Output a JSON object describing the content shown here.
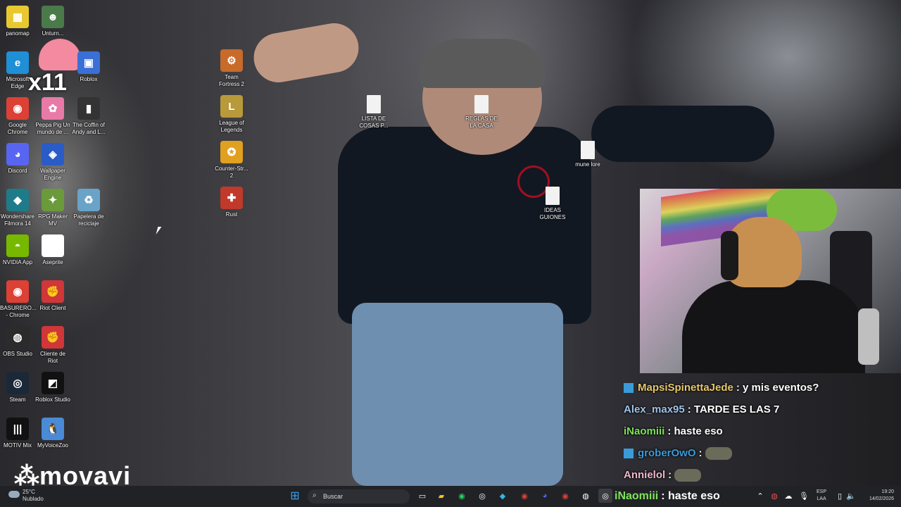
{
  "desktop": {
    "icons": [
      {
        "label": "panomap",
        "color": "#e8c830",
        "glyph": "▦"
      },
      {
        "label": "Unturn...",
        "color": "#4b7a4a",
        "glyph": "☻"
      },
      {
        "label": "Microsoft Edge",
        "color": "#1f8fd6",
        "glyph": "e"
      },
      {
        "label": "Roblox",
        "color": "#3a6fd6",
        "glyph": "▣"
      },
      {
        "label": "Google Chrome",
        "color": "#dd4035",
        "glyph": "◉"
      },
      {
        "label": "Peppa Pig Un mundo de ...",
        "color": "#e87aa8",
        "glyph": "✿"
      },
      {
        "label": "The Coffin of Andy and L...",
        "color": "#333333",
        "glyph": "▮"
      },
      {
        "label": "Discord",
        "color": "#5865f2",
        "glyph": "◕"
      },
      {
        "label": "Wallpaper Engine",
        "color": "#2a5bc7",
        "glyph": "◈"
      },
      {
        "label": "Wondershare Filmora 14",
        "color": "#1e7b8a",
        "glyph": "◆"
      },
      {
        "label": "RPG Maker MV",
        "color": "#6a9a3a",
        "glyph": "✦"
      },
      {
        "label": "Papelera de reciclaje",
        "color": "#6aa3c8",
        "glyph": "♻"
      },
      {
        "label": "NVIDIA App",
        "color": "#76b900",
        "glyph": "◓"
      },
      {
        "label": "Aseprite",
        "color": "#ffffff",
        "glyph": "▢"
      },
      {
        "label": "BASURERO... - Chrome",
        "color": "#dd4035",
        "glyph": "◉"
      },
      {
        "label": "Riot Client",
        "color": "#d13639",
        "glyph": "✊"
      },
      {
        "label": "OBS Studio",
        "color": "#2b2b2b",
        "glyph": "◍"
      },
      {
        "label": "Cliente de Riot",
        "color": "#d13639",
        "glyph": "✊"
      },
      {
        "label": "Steam",
        "color": "#1b2838",
        "glyph": "◎"
      },
      {
        "label": "Roblox Studio",
        "color": "#111111",
        "glyph": "◩"
      },
      {
        "label": "MOTIV Mix",
        "color": "#111111",
        "glyph": "|||"
      },
      {
        "label": "MyVoiceZoo",
        "color": "#4a8ad6",
        "glyph": "🐧"
      },
      {
        "label": "Team Fortress 2",
        "color": "#c86a2a",
        "glyph": "⚙"
      },
      {
        "label": "League of Legends",
        "color": "#b89a3a",
        "glyph": "L"
      },
      {
        "label": "Counter-Str... 2",
        "color": "#e0a020",
        "glyph": "✪"
      },
      {
        "label": "Rust",
        "color": "#c0392b",
        "glyph": "✚"
      },
      {
        "label": "LISTA DE COSAS P...",
        "color": "#f2f2f2",
        "glyph": ""
      },
      {
        "label": "REGLAS DE LA CASA",
        "color": "#f2f2f2",
        "glyph": ""
      },
      {
        "label": "mune lore",
        "color": "#f2f2f2",
        "glyph": ""
      },
      {
        "label": "IDEAS GUIONES",
        "color": "#f2f2f2",
        "glyph": ""
      }
    ],
    "sticker_text": "x11"
  },
  "chat": {
    "messages": [
      {
        "user": "MapsiSpinettaJede",
        "user_color": "#e8c86a",
        "text": ": y mis eventos?",
        "badge": true,
        "emote": false
      },
      {
        "user": "Alex_max95",
        "user_color": "#9fc3e8",
        "text": ": TARDE ES LAS 7",
        "badge": false,
        "emote": false
      },
      {
        "user": "iNaomiii",
        "user_color": "#7fe35a",
        "text": ": haste eso",
        "badge": false,
        "emote": false
      },
      {
        "user": "groberOwO",
        "user_color": "#3a9bd8",
        "text": ":",
        "badge": true,
        "emote": true
      },
      {
        "user": "Annielol",
        "user_color": "#f0b8c8",
        "text": ":",
        "badge": false,
        "emote": true
      }
    ]
  },
  "watermark": "movavi",
  "taskbar": {
    "weather_temp": "25°C",
    "weather_desc": "Nublado",
    "search_placeholder": "Buscar",
    "lang_line1": "ESP",
    "lang_line2": "LAA",
    "time": "19:20",
    "date": "14/02/2026",
    "overlay_user": "iNaomiii",
    "overlay_text": ": haste eso"
  }
}
